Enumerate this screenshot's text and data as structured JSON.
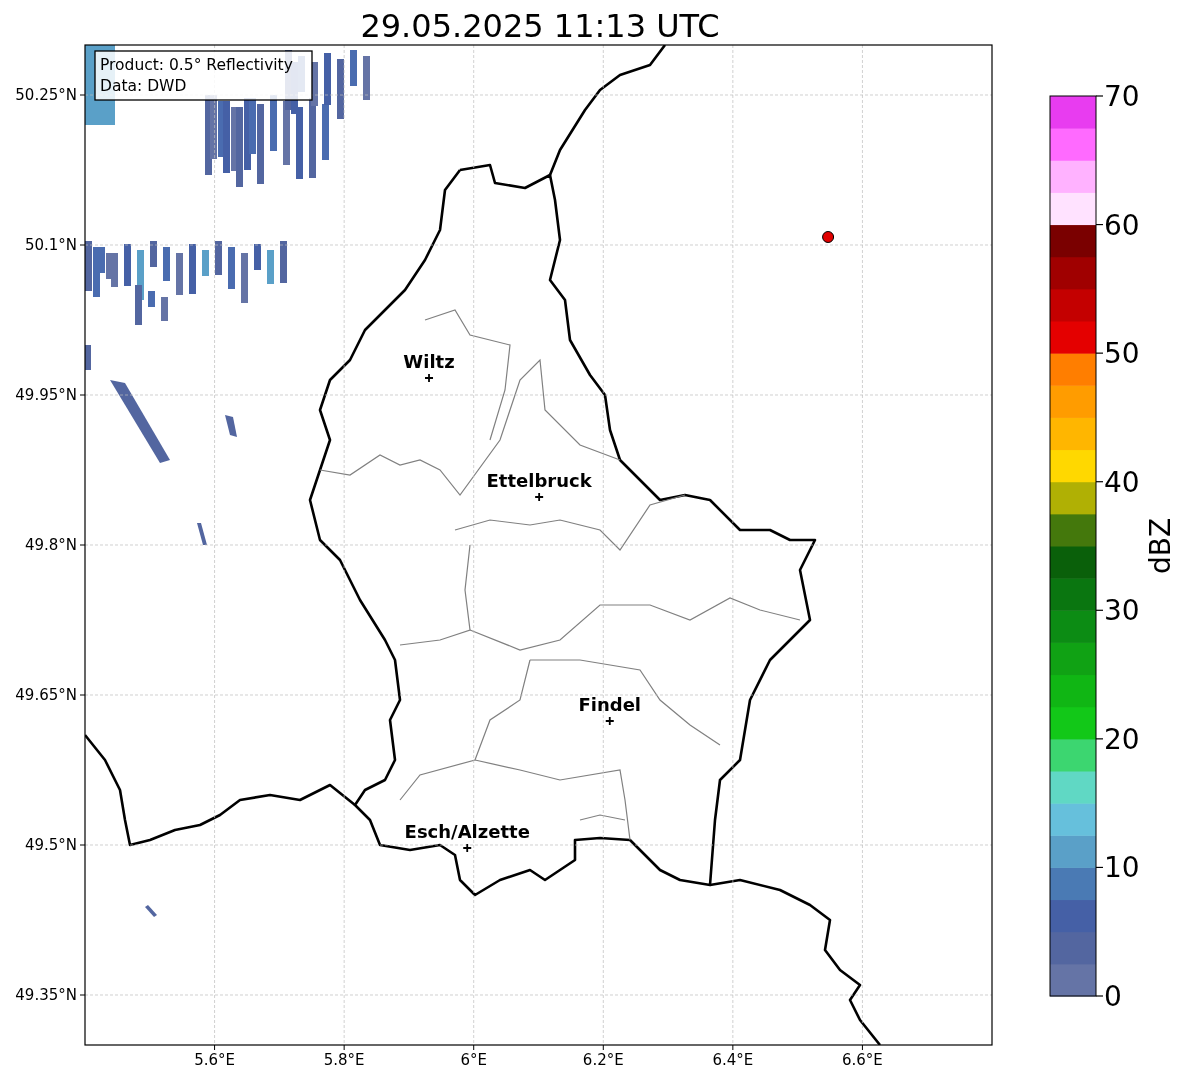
{
  "map": {
    "info_box": {
      "lines": [
        "Product: 0.5° Reflectivity",
        "Data: DWD"
      ]
    },
    "chart_data": {
      "type": "scatter",
      "title": "29.05.2025 11:13 UTC",
      "x": [
        5.931,
        6.101,
        6.21,
        5.99,
        6.547
      ],
      "series": [
        {
          "color": "#000000",
          "values": [
            49.967,
            49.848,
            49.624,
            49.497,
            null
          ]
        },
        {
          "color": "#e00000",
          "values": [
            null,
            null,
            null,
            null,
            50.108
          ]
        }
      ],
      "grid": true,
      "xlim": [
        5.4,
        6.8
      ],
      "ylim": [
        49.3,
        50.3
      ],
      "xticks": [
        {
          "value": 5.6,
          "label": "5.6°E"
        },
        {
          "value": 5.8,
          "label": "5.8°E"
        },
        {
          "value": 6.0,
          "label": "6°E"
        },
        {
          "value": 6.2,
          "label": "6.2°E"
        },
        {
          "value": 6.4,
          "label": "6.4°E"
        },
        {
          "value": 6.6,
          "label": "6.6°E"
        }
      ],
      "yticks": [
        {
          "value": 50.25,
          "label": "50.25°N"
        },
        {
          "value": 50.1,
          "label": "50.1°N"
        },
        {
          "value": 49.95,
          "label": "49.95°N"
        },
        {
          "value": 49.8,
          "label": "49.8°N"
        },
        {
          "value": 49.65,
          "label": "49.65°N"
        },
        {
          "value": 49.5,
          "label": "49.5°N"
        },
        {
          "value": 49.35,
          "label": "49.35°N"
        }
      ],
      "annotations": [
        {
          "x": 5.931,
          "y": 49.967,
          "text": "Wiltz"
        },
        {
          "x": 6.101,
          "y": 49.848,
          "text": "Ettelbruck"
        },
        {
          "x": 6.21,
          "y": 49.624,
          "text": "Findel"
        },
        {
          "x": 5.99,
          "y": 49.497,
          "text": "Esch/Alzette"
        }
      ]
    }
  },
  "colorbar": {
    "label": "dBZ",
    "ticks": [
      "70",
      "60",
      "50",
      "40",
      "30",
      "20",
      "10",
      "0"
    ],
    "segments": [
      {
        "color": "#6574a6"
      },
      {
        "color": "#5366a0"
      },
      {
        "color": "#4560a6"
      },
      {
        "color": "#4a7ab4"
      },
      {
        "color": "#5aa0c8"
      },
      {
        "color": "#66c0dc"
      },
      {
        "color": "#60d8c4"
      },
      {
        "color": "#3cd670"
      },
      {
        "color": "#12c818"
      },
      {
        "color": "#10b614"
      },
      {
        "color": "#10a214"
      },
      {
        "color": "#0c8c14"
      },
      {
        "color": "#0a7610"
      },
      {
        "color": "#0a600a"
      },
      {
        "color": "#44780c"
      },
      {
        "color": "#b0b004"
      },
      {
        "color": "#ffd800"
      },
      {
        "color": "#ffb600"
      },
      {
        "color": "#ff9c00"
      },
      {
        "color": "#ff7e00"
      },
      {
        "color": "#e40000"
      },
      {
        "color": "#c40000"
      },
      {
        "color": "#a00000"
      },
      {
        "color": "#7a0000"
      },
      {
        "color": "#ffe2ff"
      },
      {
        "color": "#ffb2ff"
      },
      {
        "color": "#ff6aff"
      },
      {
        "color": "#e83cf0"
      }
    ]
  }
}
